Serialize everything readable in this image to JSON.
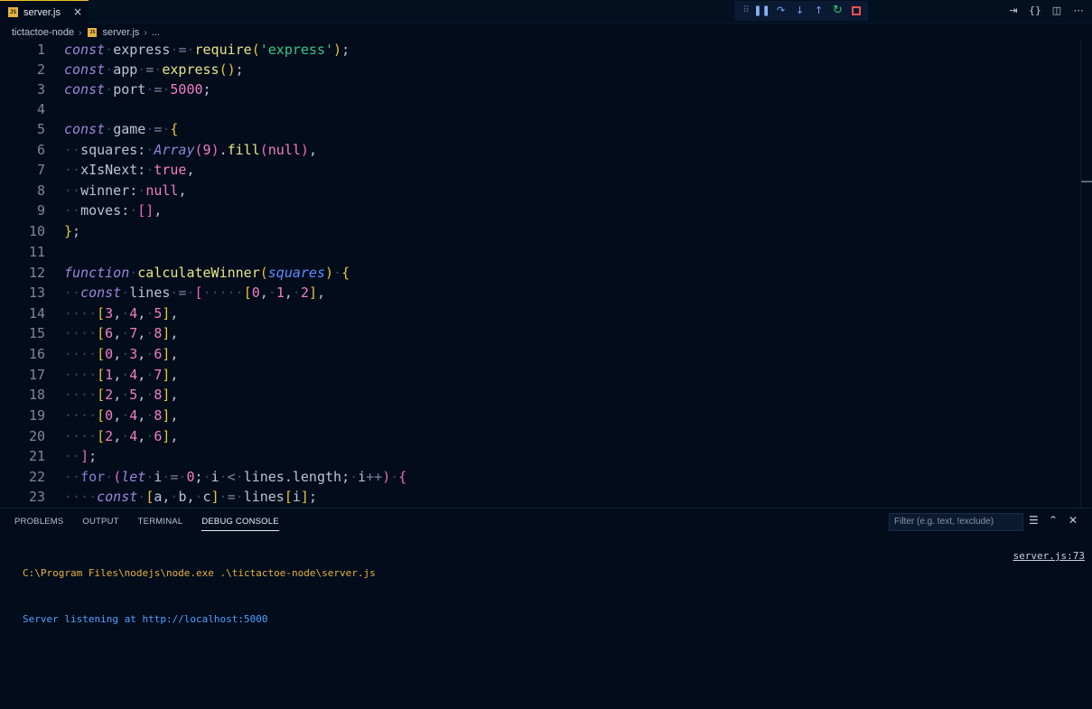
{
  "tab": {
    "badge": "JS",
    "label": "server.js",
    "close": "×"
  },
  "breadcrumb": {
    "folder": "tictactoe-node",
    "file": "server.js",
    "more": "..."
  },
  "panel": {
    "tabs": [
      "PROBLEMS",
      "OUTPUT",
      "TERMINAL",
      "DEBUG CONSOLE"
    ],
    "filter_placeholder": "Filter (e.g. text, !exclude)",
    "console_lines": [
      "C:\\Program Files\\nodejs\\node.exe .\\tictactoe-node\\server.js",
      "Server listening at http://localhost:5000"
    ],
    "source_link": "server.js:73"
  },
  "editor": {
    "line_numbers": [
      "1",
      "2",
      "3",
      "4",
      "5",
      "6",
      "7",
      "8",
      "9",
      "10",
      "11",
      "12",
      "13",
      "14",
      "15",
      "16",
      "17",
      "18",
      "19",
      "20",
      "21",
      "22",
      "23"
    ]
  }
}
